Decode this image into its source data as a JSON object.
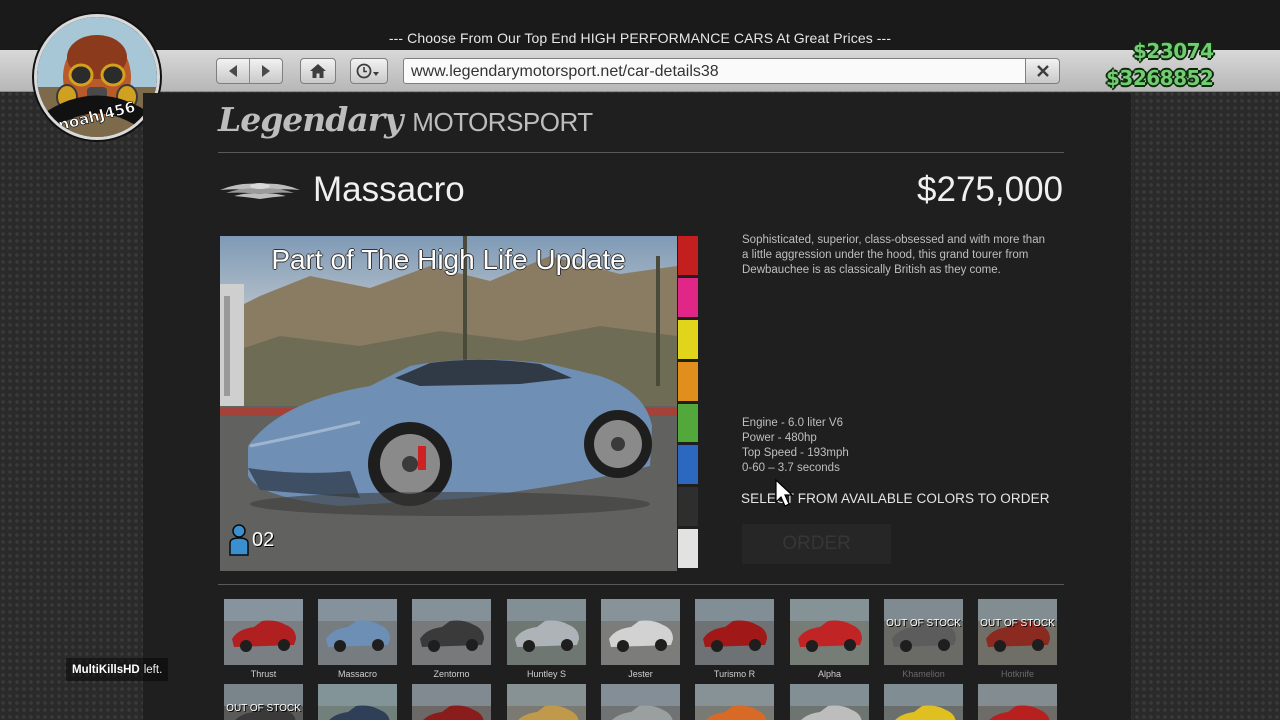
{
  "browser": {
    "tagline": "--- Choose From Our Top End HIGH PERFORMANCE CARS At Great Prices ---",
    "url": "www.legendarymotorsport.net/car-details38"
  },
  "hud": {
    "cash": "$23074",
    "bank": "$3268852",
    "player_name": "noahJ456"
  },
  "site": {
    "logo_script": "Legendary",
    "logo_word": "MOTORSPORT"
  },
  "car": {
    "name": "Massacro",
    "price": "$275,000",
    "photo_title": "Part of The High Life Update",
    "seats": "02",
    "description": "Sophisticated, superior, class-obsessed and with more than a little aggression under the hood, this grand tourer from Dewbauchee is as classically British as they come.",
    "specs": [
      "Engine - 6.0 liter V6",
      "Power - 480hp",
      "Top Speed - 193mph",
      "0-60 – 3.7 seconds"
    ],
    "select_prompt": "SELECT FROM AVAILABLE COLORS TO ORDER",
    "order_label": "ORDER",
    "colors": [
      "#c41f1f",
      "#e02686",
      "#e0d51a",
      "#e08f1c",
      "#52a83a",
      "#2c68c0",
      "#2e2e2e",
      "#e2e2e2"
    ]
  },
  "thumbnails_row1": [
    {
      "label": "Thrust",
      "stock": "",
      "dim": false,
      "car": "#b02020",
      "bg": "#7a7f84"
    },
    {
      "label": "Massacro",
      "stock": "",
      "dim": false,
      "car": "#6d8fb6",
      "bg": "#767c7f"
    },
    {
      "label": "Zentorno",
      "stock": "",
      "dim": false,
      "car": "#3a3a3a",
      "bg": "#77797a"
    },
    {
      "label": "Huntley S",
      "stock": "",
      "dim": false,
      "car": "#aeb3b8",
      "bg": "#6f7772"
    },
    {
      "label": "Jester",
      "stock": "",
      "dim": false,
      "car": "#d2d2d2",
      "bg": "#7c7d7a"
    },
    {
      "label": "Turismo R",
      "stock": "",
      "dim": false,
      "car": "#a01818",
      "bg": "#6e7274"
    },
    {
      "label": "Alpha",
      "stock": "",
      "dim": false,
      "car": "#c02424",
      "bg": "#757d76"
    },
    {
      "label": "Khamelion",
      "stock": "OUT OF STOCK",
      "dim": true,
      "car": "#5c5c5c",
      "bg": "#6a6a66"
    },
    {
      "label": "Hotknife",
      "stock": "OUT OF STOCK",
      "dim": true,
      "car": "#8a2a20",
      "bg": "#6f6f68"
    }
  ],
  "thumbnails_row2": [
    {
      "stock": "OUT OF STOCK",
      "car": "#3a3a3a",
      "bg": "#5a5a58"
    },
    {
      "stock": "",
      "car": "#2f3f58",
      "bg": "#72807c"
    },
    {
      "stock": "",
      "car": "#8a1c1c",
      "bg": "#6b6865"
    },
    {
      "stock": "",
      "car": "#c09a4a",
      "bg": "#7a7a72"
    },
    {
      "stock": "",
      "car": "#9aa0a0",
      "bg": "#707273"
    },
    {
      "stock": "",
      "car": "#d86a26",
      "bg": "#7a7a74"
    },
    {
      "stock": "",
      "car": "#bdbdbd",
      "bg": "#6e746f"
    },
    {
      "stock": "",
      "car": "#e0c020",
      "bg": "#6a6e6c"
    },
    {
      "stock": "",
      "car": "#b82020",
      "bg": "#6e6c68"
    }
  ],
  "feed": {
    "player": "MultiKillsHD",
    "message": "left."
  }
}
